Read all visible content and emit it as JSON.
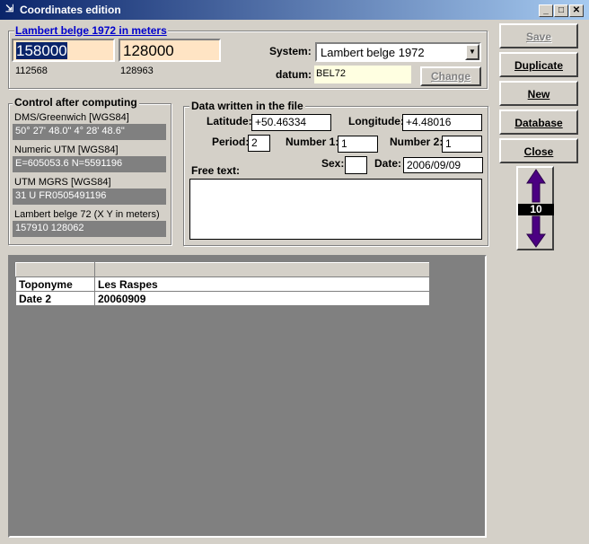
{
  "window": {
    "title": "Coordinates edition"
  },
  "projection": {
    "header": "Lambert belge 1972 in meters",
    "x_value": "158000",
    "y_value": "128000",
    "x_sub": "112568",
    "y_sub": "128963",
    "system_label": "System:",
    "system_value": "Lambert belge 1972",
    "datum_label": "datum:",
    "datum_value": "BEL72",
    "change_label": "Change"
  },
  "control": {
    "title": "Control after computing",
    "items": [
      {
        "label": "DMS/Greenwich [WGS84]",
        "value": "50° 27' 48.0\" 4° 28' 48.6\""
      },
      {
        "label": "Numeric UTM [WGS84]",
        "value": "E=605053.6  N=5591196"
      },
      {
        "label": "UTM MGRS [WGS84]",
        "value": "31 U FR0505491196"
      },
      {
        "label": "Lambert belge 72 (X Y in meters)",
        "value": "157910   128062"
      }
    ]
  },
  "data_file": {
    "title": "Data written in the file",
    "latitude_label": "Latitude:",
    "latitude_value": "+50.46334",
    "longitude_label": "Longitude:",
    "longitude_value": "+4.48016",
    "period_label": "Period:",
    "period_value": "2",
    "number1_label": "Number 1:",
    "number1_value": "1",
    "number2_label": "Number 2:",
    "number2_value": "1",
    "free_text_label": "Free text:",
    "sex_label": "Sex:",
    "sex_value": "",
    "date_label": "Date:",
    "date_value": "2006/09/09",
    "free_text_value": ""
  },
  "buttons": {
    "save": "Save",
    "duplicate": "Duplicate",
    "new": "New",
    "database": "Database",
    "close": "Close"
  },
  "navigator": {
    "record_number": "10"
  },
  "grid": {
    "rows": [
      {
        "field": "Toponyme",
        "value": "Les Raspes"
      },
      {
        "field": "Date 2",
        "value": "20060909"
      }
    ]
  }
}
